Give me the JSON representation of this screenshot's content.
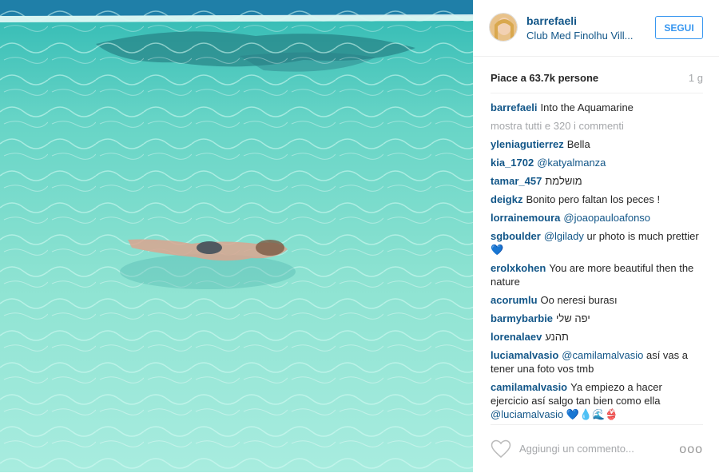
{
  "post": {
    "username": "barrefaeli",
    "location": "Club Med Finolhu Vill...",
    "follow_label": "SEGUI",
    "likes": "Piace a 63.7k persone",
    "time": "1 g"
  },
  "caption": {
    "user": "barrefaeli",
    "text": "Into the Aquamarine"
  },
  "more_comments": "mostra tutti e 320 i commenti",
  "comments": [
    {
      "user": "yleniagutierrez",
      "text": "Bella"
    },
    {
      "user": "kia_1702",
      "mention": "@katyalmanza"
    },
    {
      "user": "tamar_457",
      "text": "מושלמת"
    },
    {
      "user": "deigkz",
      "text": "Bonito pero faltan los peces !"
    },
    {
      "user": "lorrainemoura",
      "mention": "@joaopauloafonso"
    },
    {
      "user": "sgboulder",
      "mention": "@lgilady",
      "text": "ur photo is much prettier",
      "emoji": "💙"
    },
    {
      "user": "erolxkohen",
      "text": "You are more beautiful then the nature"
    },
    {
      "user": "acorumlu",
      "text": "Oo neresi burası"
    },
    {
      "user": "barmybarbie",
      "text": "יפה שלי"
    },
    {
      "user": "lorenalaev",
      "text": "תהנע"
    },
    {
      "user": "luciamalvasio",
      "mention": "@camilamalvasio",
      "text": "así vas a tener una foto vos tmb"
    },
    {
      "user": "camilamalvasio",
      "text": "Ya empiezo a hacer ejercicio así salgo tan bien como ella",
      "mention2": "@luciamalvasio",
      "emoji": "💙💧🌊👙"
    }
  ],
  "footer": {
    "placeholder": "Aggiungi un commento...",
    "options": "ooo"
  },
  "icons": {
    "like": "heart-outline-icon",
    "options": "ellipsis-icon"
  },
  "colors": {
    "username": "#125688",
    "follow": "#3897f0",
    "muted": "#a5a7aa",
    "text": "#262626"
  }
}
